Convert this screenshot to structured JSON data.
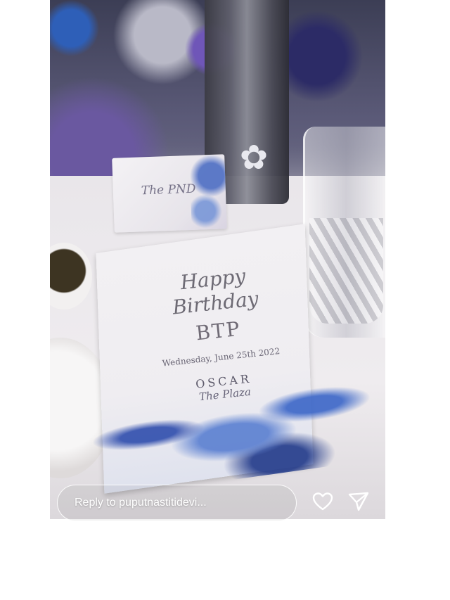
{
  "story": {
    "place_card": {
      "text": "The PND"
    },
    "menu_card": {
      "line1": "Happy",
      "line2": "Birthday",
      "initials": "BTP",
      "date": "Wednesday, June 25th 2022",
      "venue": "OSCAR",
      "venue_sub": "The Plaza"
    }
  },
  "reply": {
    "placeholder": "Reply to puputnastitidevi..."
  },
  "icons": {
    "like": "heart-icon",
    "share": "send-icon"
  }
}
